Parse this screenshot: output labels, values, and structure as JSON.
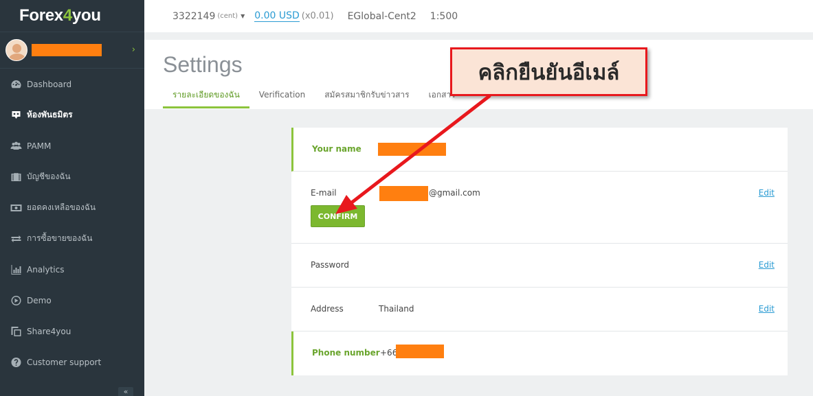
{
  "logo": {
    "part1": "Forex",
    "part2": "4",
    "part3": "you"
  },
  "sidebar": {
    "items": [
      {
        "label": "Dashboard",
        "icon": "dashboard-icon",
        "active": false
      },
      {
        "label": "ห้องพันธมิตร",
        "icon": "partner-icon",
        "active": true
      },
      {
        "label": "PAMM",
        "icon": "users-icon",
        "active": false
      },
      {
        "label": "บัญชีของฉัน",
        "icon": "briefcase-icon",
        "active": false
      },
      {
        "label": "ยอดคงเหลือของฉัน",
        "icon": "money-icon",
        "active": false
      },
      {
        "label": "การซื้อขายของฉัน",
        "icon": "exchange-icon",
        "active": false
      },
      {
        "label": "Analytics",
        "icon": "bar-chart-icon",
        "active": false
      },
      {
        "label": "Demo",
        "icon": "play-icon",
        "active": false
      },
      {
        "label": "Share4you",
        "icon": "copy-icon",
        "active": false
      },
      {
        "label": "Customer support",
        "icon": "help-icon",
        "active": false
      }
    ],
    "collapse_glyph": "«"
  },
  "topbar": {
    "account": "3322149",
    "account_type": "(cent)",
    "balance": "0.00 USD",
    "multiplier": "(x0.01)",
    "server": "EGlobal-Cent2",
    "leverage": "1:500"
  },
  "settings": {
    "title": "Settings",
    "tabs": [
      "รายละเอียดของฉัน",
      "Verification",
      "สมัครสมาชิกรับข่าวสาร",
      "เอกสาร"
    ]
  },
  "profile": {
    "name_label": "Your name",
    "email_label": "E-mail",
    "email_suffix": "@gmail.com",
    "confirm_label": "CONFIRM",
    "password_label": "Password",
    "address_label": "Address",
    "address_value": "Thailand",
    "phone_label": "Phone number",
    "phone_prefix": "+66",
    "edit_label": "Edit"
  },
  "callout": {
    "text": "คลิกยืนยันอีเมล์"
  },
  "colors": {
    "accent": "#8cc43c",
    "sidebar": "#2a353d",
    "link": "#2a9bd3",
    "redaction": "#ff7f10",
    "callout_border": "#e8181d"
  }
}
